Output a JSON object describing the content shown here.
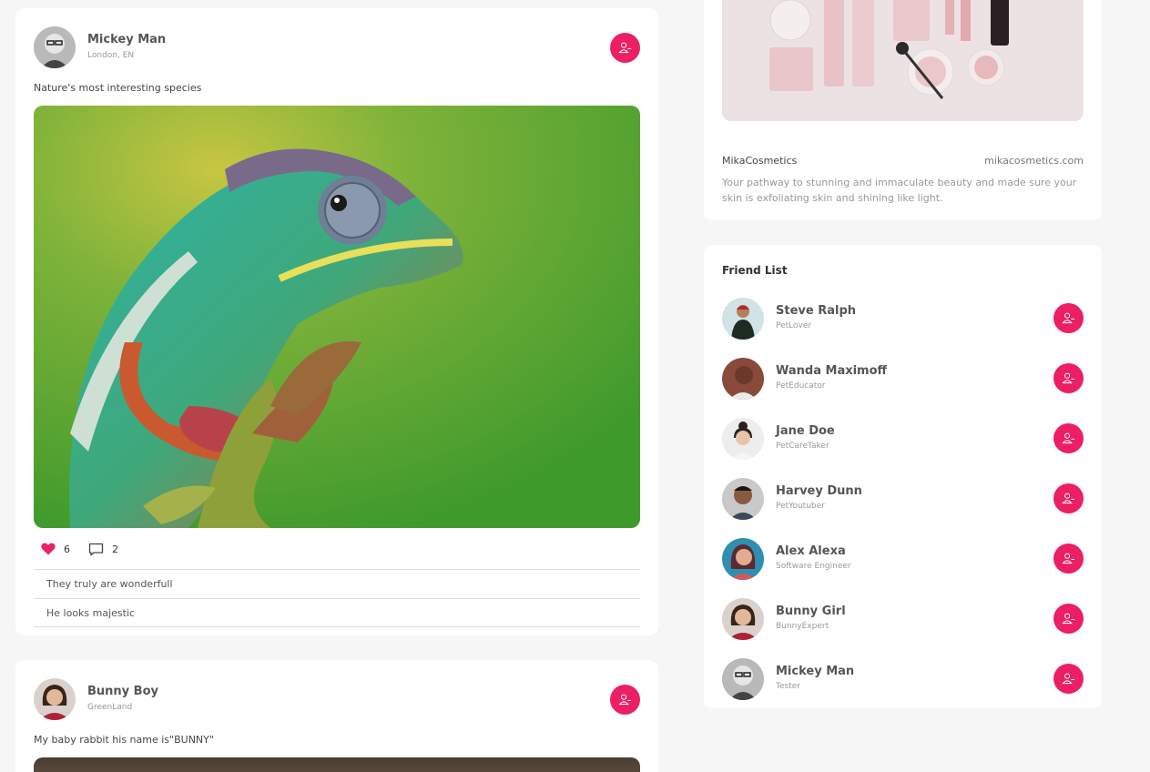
{
  "posts": [
    {
      "author": "Mickey Man",
      "location": "London, EN",
      "text": "Nature's most interesting species",
      "likes": "6",
      "comments_count": "2",
      "comments": [
        "They truly are wonderfull",
        "He looks majestic"
      ]
    },
    {
      "author": "Bunny Boy",
      "location": "GreenLand",
      "text": "My baby rabbit his name is\"BUNNY\""
    }
  ],
  "ad": {
    "name": "MikaCosmetics",
    "url": "mikacosmetics.com",
    "description": "Your pathway to stunning and immaculate beauty and made sure your skin is exfoliating skin and shining like light."
  },
  "friend_list": {
    "title": "Friend List",
    "friends": [
      {
        "name": "Steve Ralph",
        "role": "PetLover"
      },
      {
        "name": "Wanda Maximoff",
        "role": "PetEducator"
      },
      {
        "name": "Jane Doe",
        "role": "PetCareTaker"
      },
      {
        "name": "Harvey Dunn",
        "role": "PetYoutuber"
      },
      {
        "name": "Alex Alexa",
        "role": "Software Engineer"
      },
      {
        "name": "Bunny Girl",
        "role": "BunnyExpert"
      },
      {
        "name": "Mickey Man",
        "role": "Tester"
      }
    ]
  },
  "icons": {
    "remove_friend": "user-minus-icon",
    "like": "heart-icon",
    "comment": "comment-icon"
  },
  "colors": {
    "accent": "#ec1e64",
    "background": "#f6f6f6",
    "card": "#ffffff"
  }
}
